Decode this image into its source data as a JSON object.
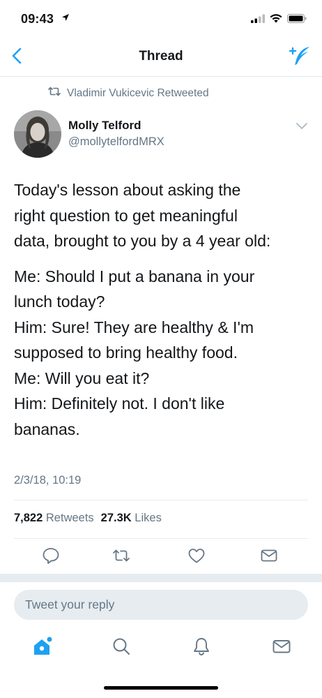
{
  "status_bar": {
    "time": "09:43"
  },
  "nav": {
    "title": "Thread"
  },
  "retweet_notice": "Vladimir Vukicevic Retweeted",
  "author": {
    "name": "Molly Telford",
    "handle": "@mollytelfordMRX"
  },
  "tweet": {
    "lines": [
      "Today's lesson about asking the",
      "right question to get meaningful",
      "data, brought to you by a 4 year old:"
    ],
    "dialog_lines": [
      "Me: Should I put a banana in your",
      "lunch today?",
      "Him: Sure! They are healthy & I'm",
      "supposed to bring healthy food.",
      "Me: Will you eat it?",
      "Him: Definitely not. I don't like",
      "bananas."
    ],
    "date": "2/3/18, 10:19"
  },
  "stats": {
    "retweets_count": "7,822",
    "retweets_label": "Retweets",
    "likes_count": "27.3K",
    "likes_label": "Likes"
  },
  "reply": {
    "placeholder": "Tweet your reply"
  },
  "colors": {
    "accent": "#1da1f2",
    "secondary_text": "#657786",
    "divider": "#e6ecf0"
  },
  "icons": {
    "nav": [
      "back-chevron-icon",
      "compose-feather-icon"
    ],
    "actions": [
      "reply-icon",
      "retweet-icon",
      "like-heart-icon",
      "direct-message-icon"
    ],
    "tabs": [
      "home-icon",
      "search-icon",
      "notifications-bell-icon",
      "messages-envelope-icon"
    ]
  }
}
